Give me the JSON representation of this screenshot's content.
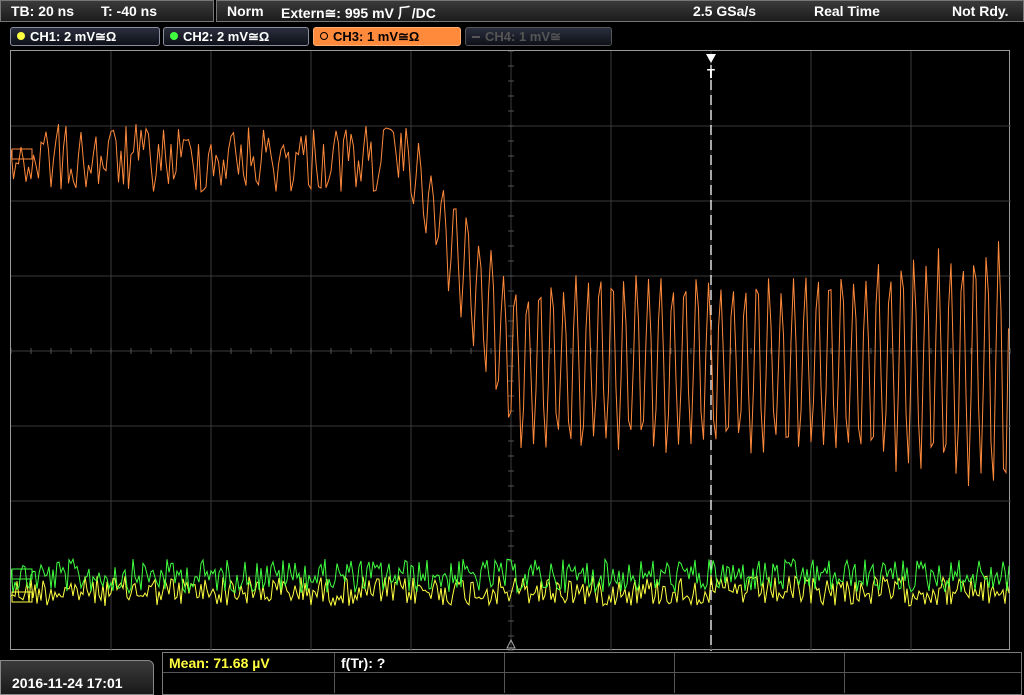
{
  "topbar": {
    "timebase": "TB: 20 ns",
    "trigger_time": "T: -40 ns",
    "trigger_mode": "Norm",
    "trigger_source": "Extern≅: 995 mV ⺁/DC",
    "sample_rate": "2.5 GSa/s",
    "acq_mode": "Real Time",
    "status": "Not Rdy."
  },
  "channels": [
    {
      "label": "CH1: 2 mV≅Ω",
      "color": "#ffff40"
    },
    {
      "label": "CH2: 2 mV≅Ω",
      "color": "#40ff40"
    },
    {
      "label": "CH3: 1 mV≅Ω",
      "color": "#ff8a3c"
    },
    {
      "label": "CH4: 1 mV≅",
      "color": "#777777"
    }
  ],
  "trigger_marker": "T",
  "bottom": {
    "datetime": "2016-11-24 17:01",
    "mean": "Mean: 71.68 µV",
    "ftr": "f(Tr): ?"
  },
  "colors": {
    "ch1": "#ffff40",
    "ch2": "#40ff40",
    "ch3": "#ff8a3c",
    "grid": "#3a3a3a",
    "trigger_line": "#ffffff",
    "mean_text": "#ffff40"
  }
}
